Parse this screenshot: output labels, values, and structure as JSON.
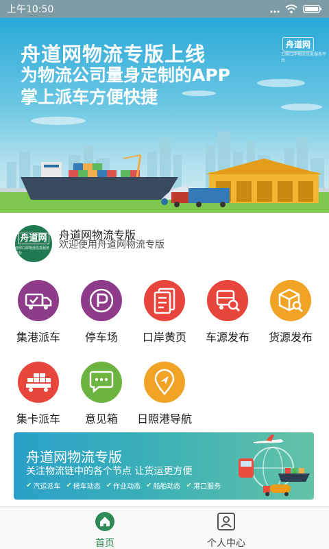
{
  "status_bar": {
    "time": "上午10:50",
    "icons": [
      "signal-icon",
      "wifi-icon",
      "battery-icon"
    ]
  },
  "hero": {
    "line1": "舟道网物流专版上线",
    "line2": "为物流公司量身定制的APP",
    "line3": "掌上派车方便快捷",
    "logo_text": "舟道网",
    "logo_sub": "日照口岸物流信息服务平台",
    "colors": {
      "sky_top": "#29a8d8",
      "warehouse": "#f2b632",
      "ship": "#3a4a5e",
      "truck": "#c0392b"
    }
  },
  "app_info": {
    "logo_text": "舟道网",
    "logo_sub": "日照口岸物流信息服务平台",
    "name": "舟道网物流专版",
    "welcome": "欢迎使用舟道网物流专版"
  },
  "grid": [
    {
      "label": "集港派车",
      "icon": "truck-check-icon",
      "color": "#8e3b8a"
    },
    {
      "label": "停车场",
      "icon": "parking-icon",
      "color": "#8e3b8a"
    },
    {
      "label": "口岸黄页",
      "icon": "document-icon",
      "color": "#e8463c"
    },
    {
      "label": "车源发布",
      "icon": "truck-search-icon",
      "color": "#e8463c"
    },
    {
      "label": "货源发布",
      "icon": "box-search-icon",
      "color": "#f0a325"
    },
    {
      "label": "集卡派车",
      "icon": "container-truck-icon",
      "color": "#e8463c"
    },
    {
      "label": "意见箱",
      "icon": "chat-icon",
      "color": "#6db33f"
    },
    {
      "label": "日照港导航",
      "icon": "location-icon",
      "color": "#f0a325"
    }
  ],
  "banner": {
    "title": "舟道网物流专版",
    "subtitle": "关注物流链中的各个节点 让货运更方便",
    "tags": [
      "汽运派车",
      "候车动态",
      "作业动态",
      "船舶动态",
      "港口服务"
    ]
  },
  "bottom_nav": {
    "items": [
      {
        "label": "首页",
        "icon": "home-icon",
        "active": true
      },
      {
        "label": "个人中心",
        "icon": "profile-icon",
        "active": false
      }
    ],
    "active_color": "#2e8b57"
  }
}
